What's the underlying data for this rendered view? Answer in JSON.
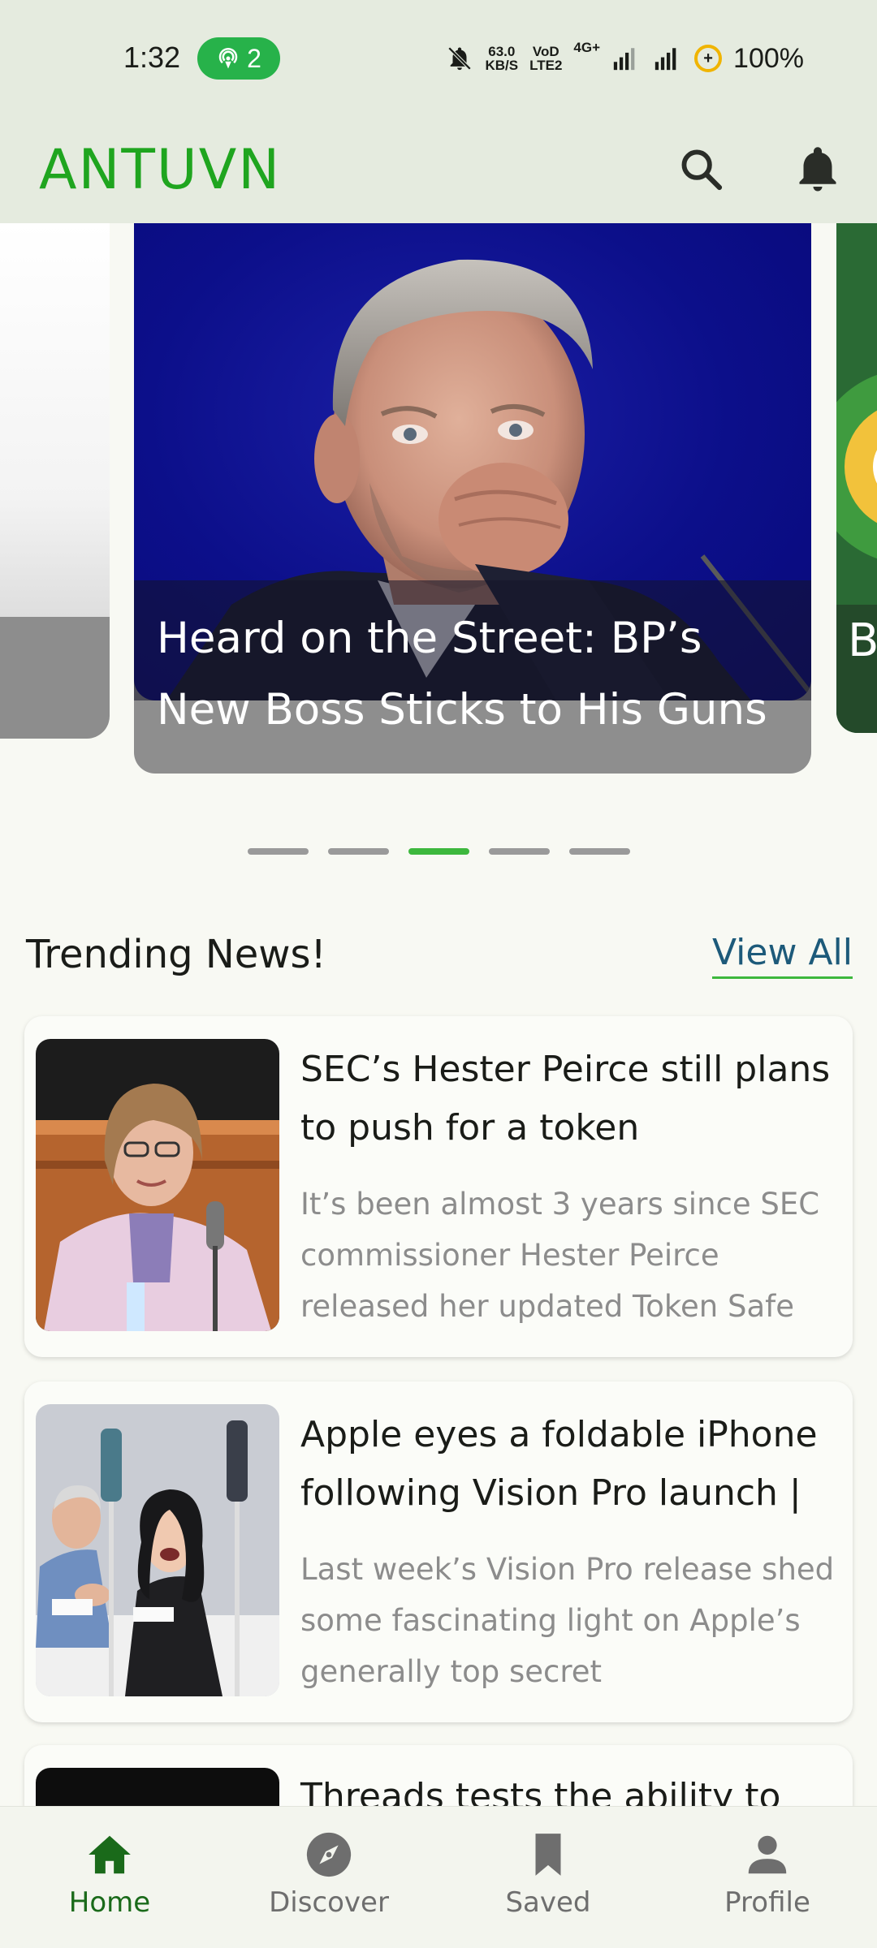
{
  "status_bar": {
    "time": "1:32",
    "hotspot_count": "2",
    "net_speed_value": "63.0",
    "net_speed_unit": "KB/S",
    "volte_top": "VoD",
    "volte_bottom": "LTE2",
    "network_type": "4G+",
    "battery": "100%"
  },
  "app_bar": {
    "brand": "ANTUVN",
    "search_icon": "search-icon",
    "notification_icon": "bell-icon"
  },
  "carousel": {
    "slides": [
      {
        "title": ""
      },
      {
        "title": "Heard on the Street: BP’s New Boss Sticks to His Guns"
      },
      {
        "title": "B"
      }
    ],
    "active_index": 2,
    "dot_count": 5
  },
  "trending": {
    "title": "Trending News!",
    "view_all": "View All",
    "items": [
      {
        "title": "SEC’s Hester Peirce still plans to push for a token",
        "description": "It’s been almost 3 years since SEC commissioner Hester Peirce released her updated Token Safe"
      },
      {
        "title": "Apple eyes a foldable iPhone following Vision Pro launch |",
        "description": "Last week’s Vision Pro release shed some fascinating light on Apple’s generally top secret"
      },
      {
        "title": "Threads tests the ability to"
      }
    ]
  },
  "bottom_nav": {
    "items": [
      {
        "label": "Home",
        "icon": "home-icon",
        "active": true
      },
      {
        "label": "Discover",
        "icon": "compass-icon",
        "active": false
      },
      {
        "label": "Saved",
        "icon": "bookmark-icon",
        "active": false
      },
      {
        "label": "Profile",
        "icon": "person-icon",
        "active": false
      }
    ]
  },
  "colors": {
    "brand": "#1fa51f",
    "active_dot": "#3db83d",
    "nav_active": "#1a6a1a",
    "view_all": "#1d5a7a"
  }
}
